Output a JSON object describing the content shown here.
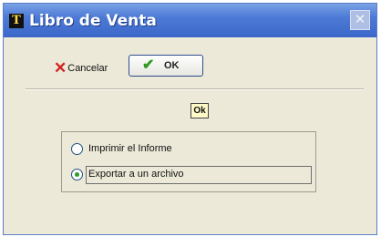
{
  "window": {
    "title": "Libro de Venta",
    "app_icon_glyph": "T",
    "close_glyph": "✕"
  },
  "toolbar": {
    "cancel_icon": "✕",
    "cancel_label": "Cancelar",
    "ok_icon": "✔",
    "ok_label": "OK"
  },
  "small_ok": {
    "label": "Ok"
  },
  "options": [
    {
      "label": "Imprimir el Informe",
      "selected": false
    },
    {
      "label": "Exportar a un archivo",
      "selected": true
    }
  ],
  "colors": {
    "titlebar": "#4d7ad6",
    "cancel_red": "#d22222",
    "ok_green": "#2f9a22",
    "dialog_bg": "#ece9d8"
  }
}
